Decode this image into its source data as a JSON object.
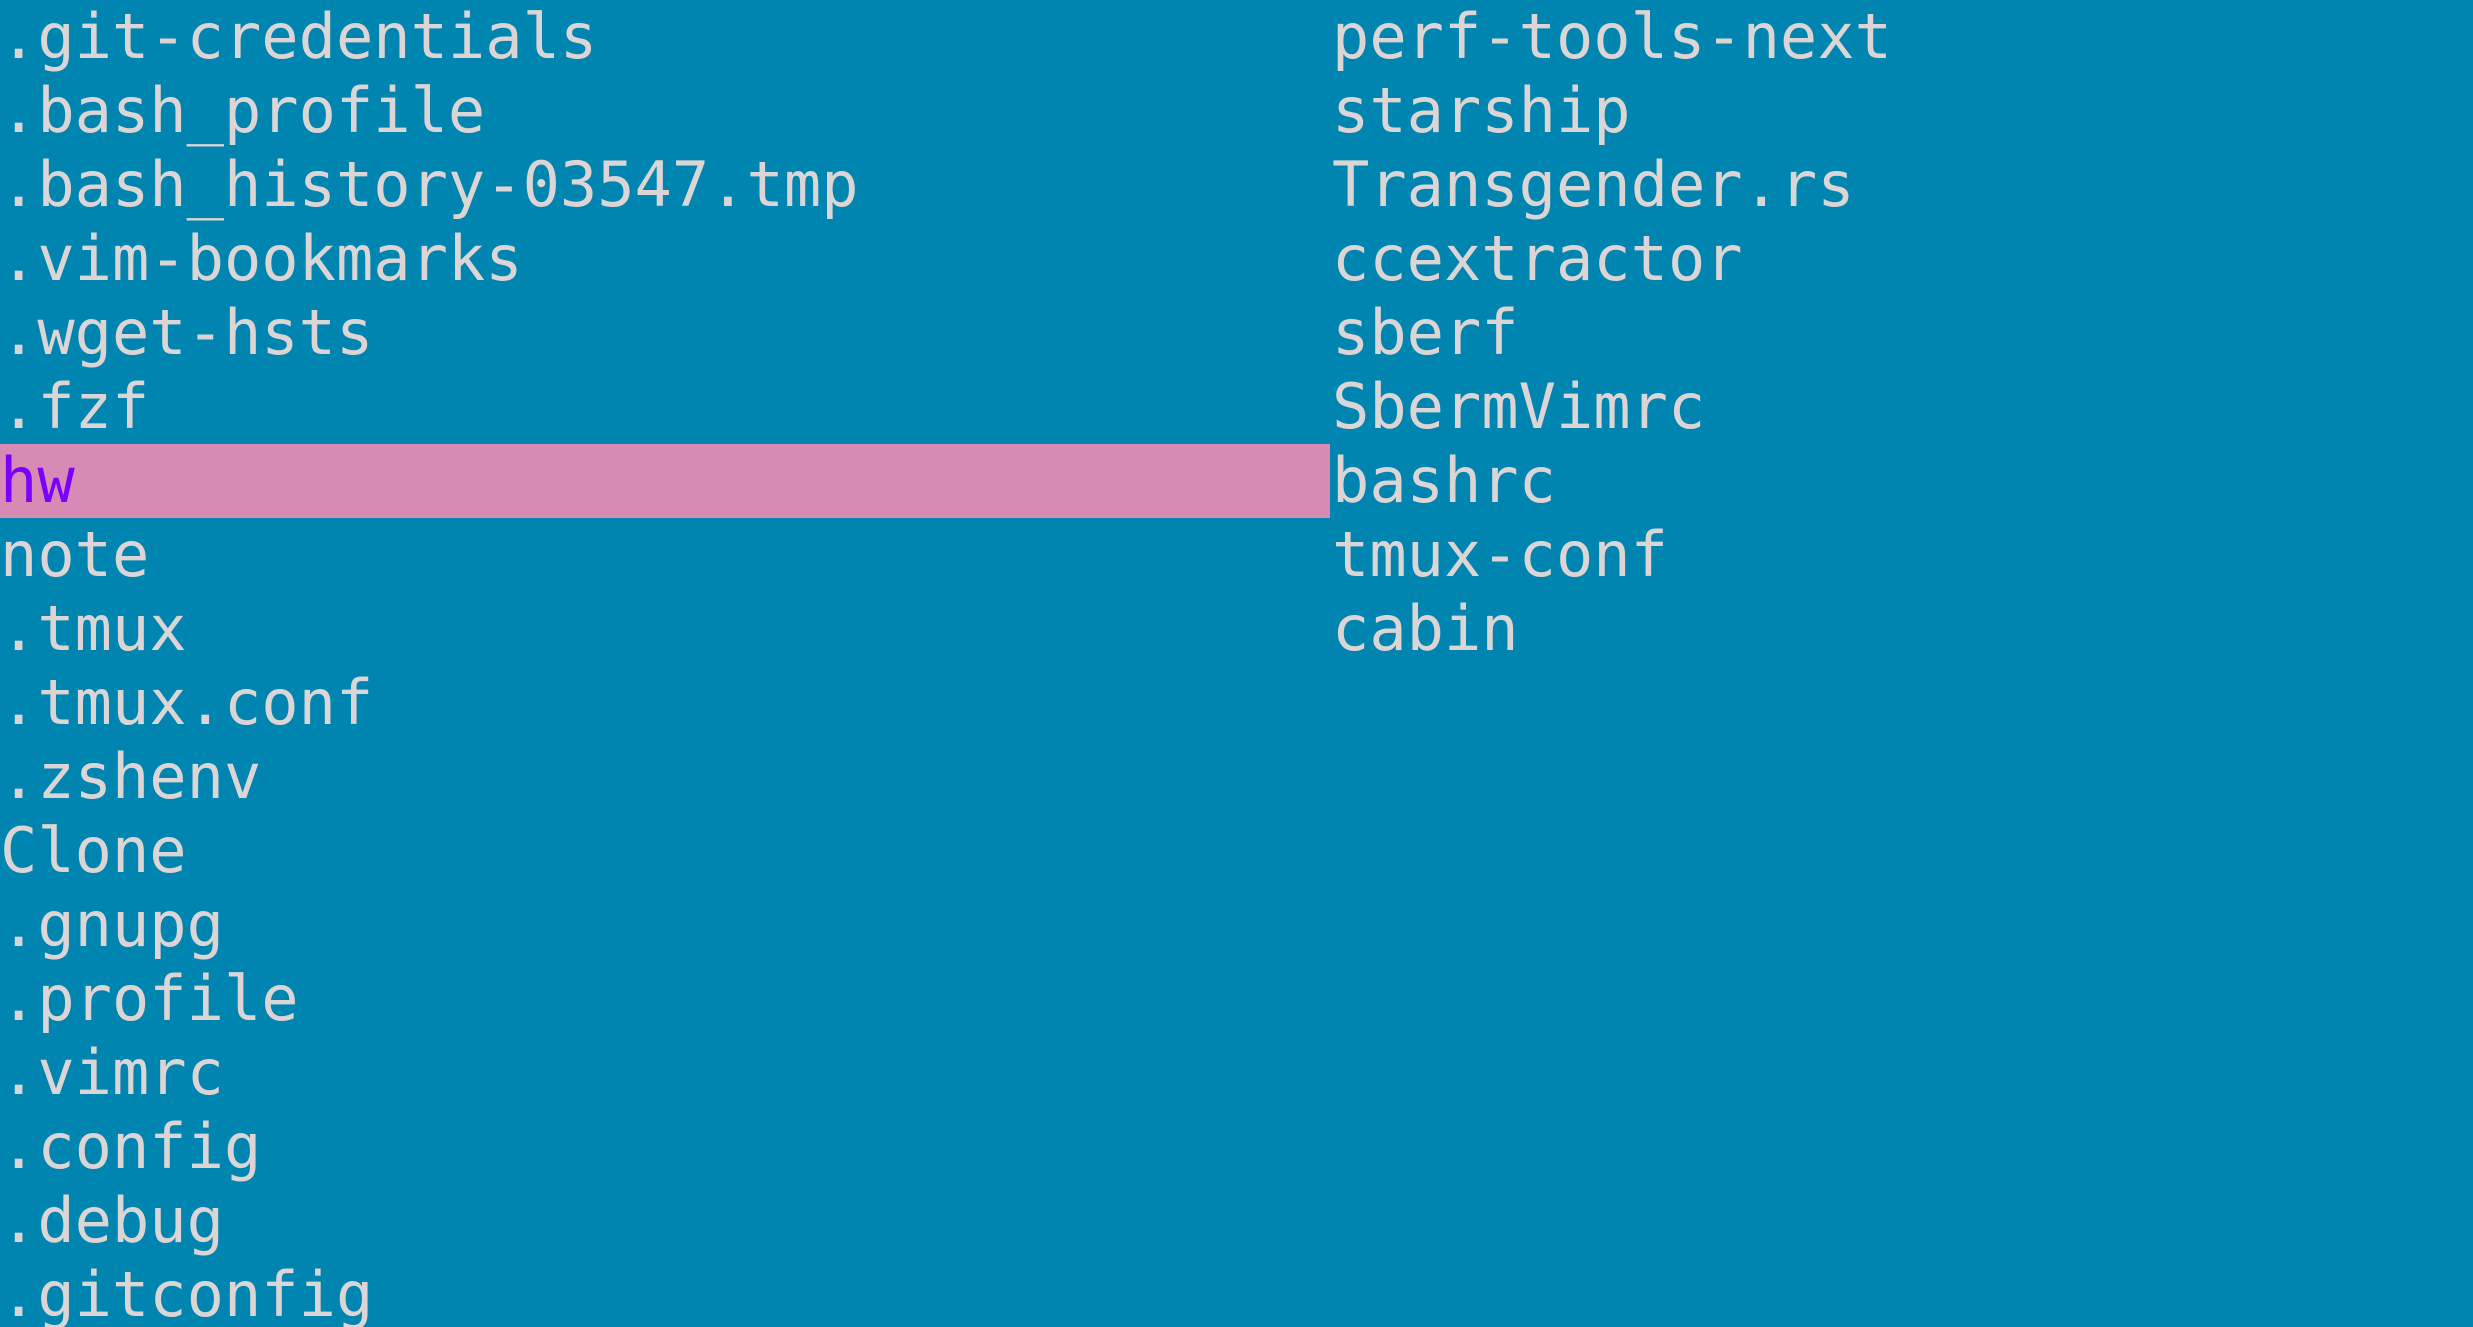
{
  "colors": {
    "background": "#0085b0",
    "text": "#dcd5d5",
    "selection_background": "#d78ab3",
    "selection_text": "#7b00ff"
  },
  "file_list": {
    "left_column": [
      ".git-credentials",
      ".bash_profile",
      ".bash_history-03547.tmp",
      ".vim-bookmarks",
      ".wget-hsts",
      ".fzf",
      "hw",
      "note",
      ".tmux",
      ".tmux.conf",
      ".zshenv",
      "Clone",
      ".gnupg",
      ".profile",
      ".vimrc",
      ".config",
      ".debug",
      ".gitconfig"
    ],
    "right_column": [
      "perf-tools-next",
      "starship",
      "Transgender.rs",
      "ccextractor",
      "sberf",
      "SbermVimrc",
      "bashrc",
      "tmux-conf",
      "cabin"
    ],
    "selected": "hw"
  }
}
